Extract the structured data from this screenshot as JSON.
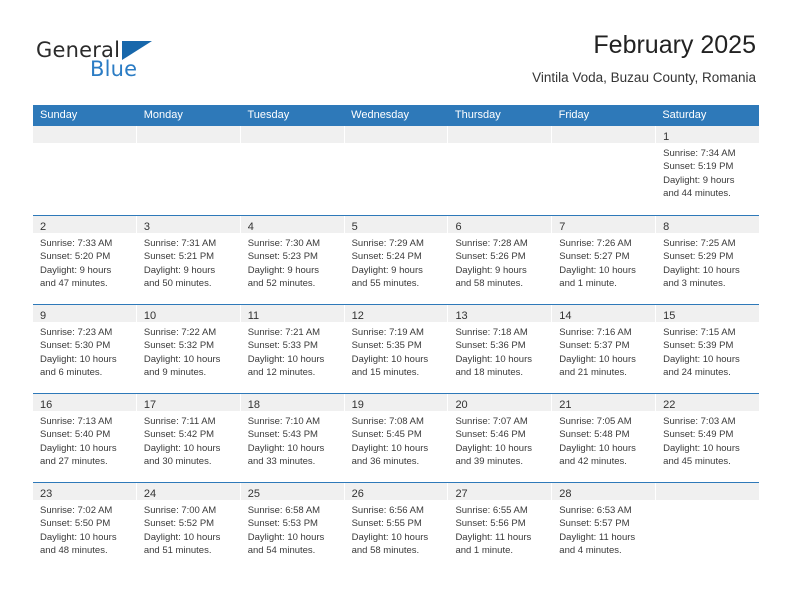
{
  "brand": {
    "word_one": "General",
    "word_two": "Blue",
    "triangle_icon": "triangle-icon",
    "accent_color": "#2b7cc4",
    "logo_triangle_color": "#1767ab"
  },
  "header": {
    "title": "February 2025",
    "subtitle": "Vintila Voda, Buzau County, Romania"
  },
  "theme": {
    "header_row_color": "#2e79b9",
    "day_band_color": "#f0f0f0",
    "text_color": "#333333"
  },
  "weekdays": [
    "Sunday",
    "Monday",
    "Tuesday",
    "Wednesday",
    "Thursday",
    "Friday",
    "Saturday"
  ],
  "weeks": [
    [
      {
        "day": "",
        "sunrise": "",
        "sunset": "",
        "daylight_line1": "",
        "daylight_line2": "",
        "empty": true
      },
      {
        "day": "",
        "sunrise": "",
        "sunset": "",
        "daylight_line1": "",
        "daylight_line2": "",
        "empty": true
      },
      {
        "day": "",
        "sunrise": "",
        "sunset": "",
        "daylight_line1": "",
        "daylight_line2": "",
        "empty": true
      },
      {
        "day": "",
        "sunrise": "",
        "sunset": "",
        "daylight_line1": "",
        "daylight_line2": "",
        "empty": true
      },
      {
        "day": "",
        "sunrise": "",
        "sunset": "",
        "daylight_line1": "",
        "daylight_line2": "",
        "empty": true
      },
      {
        "day": "",
        "sunrise": "",
        "sunset": "",
        "daylight_line1": "",
        "daylight_line2": "",
        "empty": true
      },
      {
        "day": "1",
        "sunrise": "Sunrise: 7:34 AM",
        "sunset": "Sunset: 5:19 PM",
        "daylight_line1": "Daylight: 9 hours",
        "daylight_line2": "and 44 minutes.",
        "empty": false
      }
    ],
    [
      {
        "day": "2",
        "sunrise": "Sunrise: 7:33 AM",
        "sunset": "Sunset: 5:20 PM",
        "daylight_line1": "Daylight: 9 hours",
        "daylight_line2": "and 47 minutes.",
        "empty": false
      },
      {
        "day": "3",
        "sunrise": "Sunrise: 7:31 AM",
        "sunset": "Sunset: 5:21 PM",
        "daylight_line1": "Daylight: 9 hours",
        "daylight_line2": "and 50 minutes.",
        "empty": false
      },
      {
        "day": "4",
        "sunrise": "Sunrise: 7:30 AM",
        "sunset": "Sunset: 5:23 PM",
        "daylight_line1": "Daylight: 9 hours",
        "daylight_line2": "and 52 minutes.",
        "empty": false
      },
      {
        "day": "5",
        "sunrise": "Sunrise: 7:29 AM",
        "sunset": "Sunset: 5:24 PM",
        "daylight_line1": "Daylight: 9 hours",
        "daylight_line2": "and 55 minutes.",
        "empty": false
      },
      {
        "day": "6",
        "sunrise": "Sunrise: 7:28 AM",
        "sunset": "Sunset: 5:26 PM",
        "daylight_line1": "Daylight: 9 hours",
        "daylight_line2": "and 58 minutes.",
        "empty": false
      },
      {
        "day": "7",
        "sunrise": "Sunrise: 7:26 AM",
        "sunset": "Sunset: 5:27 PM",
        "daylight_line1": "Daylight: 10 hours",
        "daylight_line2": "and 1 minute.",
        "empty": false
      },
      {
        "day": "8",
        "sunrise": "Sunrise: 7:25 AM",
        "sunset": "Sunset: 5:29 PM",
        "daylight_line1": "Daylight: 10 hours",
        "daylight_line2": "and 3 minutes.",
        "empty": false
      }
    ],
    [
      {
        "day": "9",
        "sunrise": "Sunrise: 7:23 AM",
        "sunset": "Sunset: 5:30 PM",
        "daylight_line1": "Daylight: 10 hours",
        "daylight_line2": "and 6 minutes.",
        "empty": false
      },
      {
        "day": "10",
        "sunrise": "Sunrise: 7:22 AM",
        "sunset": "Sunset: 5:32 PM",
        "daylight_line1": "Daylight: 10 hours",
        "daylight_line2": "and 9 minutes.",
        "empty": false
      },
      {
        "day": "11",
        "sunrise": "Sunrise: 7:21 AM",
        "sunset": "Sunset: 5:33 PM",
        "daylight_line1": "Daylight: 10 hours",
        "daylight_line2": "and 12 minutes.",
        "empty": false
      },
      {
        "day": "12",
        "sunrise": "Sunrise: 7:19 AM",
        "sunset": "Sunset: 5:35 PM",
        "daylight_line1": "Daylight: 10 hours",
        "daylight_line2": "and 15 minutes.",
        "empty": false
      },
      {
        "day": "13",
        "sunrise": "Sunrise: 7:18 AM",
        "sunset": "Sunset: 5:36 PM",
        "daylight_line1": "Daylight: 10 hours",
        "daylight_line2": "and 18 minutes.",
        "empty": false
      },
      {
        "day": "14",
        "sunrise": "Sunrise: 7:16 AM",
        "sunset": "Sunset: 5:37 PM",
        "daylight_line1": "Daylight: 10 hours",
        "daylight_line2": "and 21 minutes.",
        "empty": false
      },
      {
        "day": "15",
        "sunrise": "Sunrise: 7:15 AM",
        "sunset": "Sunset: 5:39 PM",
        "daylight_line1": "Daylight: 10 hours",
        "daylight_line2": "and 24 minutes.",
        "empty": false
      }
    ],
    [
      {
        "day": "16",
        "sunrise": "Sunrise: 7:13 AM",
        "sunset": "Sunset: 5:40 PM",
        "daylight_line1": "Daylight: 10 hours",
        "daylight_line2": "and 27 minutes.",
        "empty": false
      },
      {
        "day": "17",
        "sunrise": "Sunrise: 7:11 AM",
        "sunset": "Sunset: 5:42 PM",
        "daylight_line1": "Daylight: 10 hours",
        "daylight_line2": "and 30 minutes.",
        "empty": false
      },
      {
        "day": "18",
        "sunrise": "Sunrise: 7:10 AM",
        "sunset": "Sunset: 5:43 PM",
        "daylight_line1": "Daylight: 10 hours",
        "daylight_line2": "and 33 minutes.",
        "empty": false
      },
      {
        "day": "19",
        "sunrise": "Sunrise: 7:08 AM",
        "sunset": "Sunset: 5:45 PM",
        "daylight_line1": "Daylight: 10 hours",
        "daylight_line2": "and 36 minutes.",
        "empty": false
      },
      {
        "day": "20",
        "sunrise": "Sunrise: 7:07 AM",
        "sunset": "Sunset: 5:46 PM",
        "daylight_line1": "Daylight: 10 hours",
        "daylight_line2": "and 39 minutes.",
        "empty": false
      },
      {
        "day": "21",
        "sunrise": "Sunrise: 7:05 AM",
        "sunset": "Sunset: 5:48 PM",
        "daylight_line1": "Daylight: 10 hours",
        "daylight_line2": "and 42 minutes.",
        "empty": false
      },
      {
        "day": "22",
        "sunrise": "Sunrise: 7:03 AM",
        "sunset": "Sunset: 5:49 PM",
        "daylight_line1": "Daylight: 10 hours",
        "daylight_line2": "and 45 minutes.",
        "empty": false
      }
    ],
    [
      {
        "day": "23",
        "sunrise": "Sunrise: 7:02 AM",
        "sunset": "Sunset: 5:50 PM",
        "daylight_line1": "Daylight: 10 hours",
        "daylight_line2": "and 48 minutes.",
        "empty": false
      },
      {
        "day": "24",
        "sunrise": "Sunrise: 7:00 AM",
        "sunset": "Sunset: 5:52 PM",
        "daylight_line1": "Daylight: 10 hours",
        "daylight_line2": "and 51 minutes.",
        "empty": false
      },
      {
        "day": "25",
        "sunrise": "Sunrise: 6:58 AM",
        "sunset": "Sunset: 5:53 PM",
        "daylight_line1": "Daylight: 10 hours",
        "daylight_line2": "and 54 minutes.",
        "empty": false
      },
      {
        "day": "26",
        "sunrise": "Sunrise: 6:56 AM",
        "sunset": "Sunset: 5:55 PM",
        "daylight_line1": "Daylight: 10 hours",
        "daylight_line2": "and 58 minutes.",
        "empty": false
      },
      {
        "day": "27",
        "sunrise": "Sunrise: 6:55 AM",
        "sunset": "Sunset: 5:56 PM",
        "daylight_line1": "Daylight: 11 hours",
        "daylight_line2": "and 1 minute.",
        "empty": false
      },
      {
        "day": "28",
        "sunrise": "Sunrise: 6:53 AM",
        "sunset": "Sunset: 5:57 PM",
        "daylight_line1": "Daylight: 11 hours",
        "daylight_line2": "and 4 minutes.",
        "empty": false
      },
      {
        "day": "",
        "sunrise": "",
        "sunset": "",
        "daylight_line1": "",
        "daylight_line2": "",
        "empty": true
      }
    ]
  ]
}
